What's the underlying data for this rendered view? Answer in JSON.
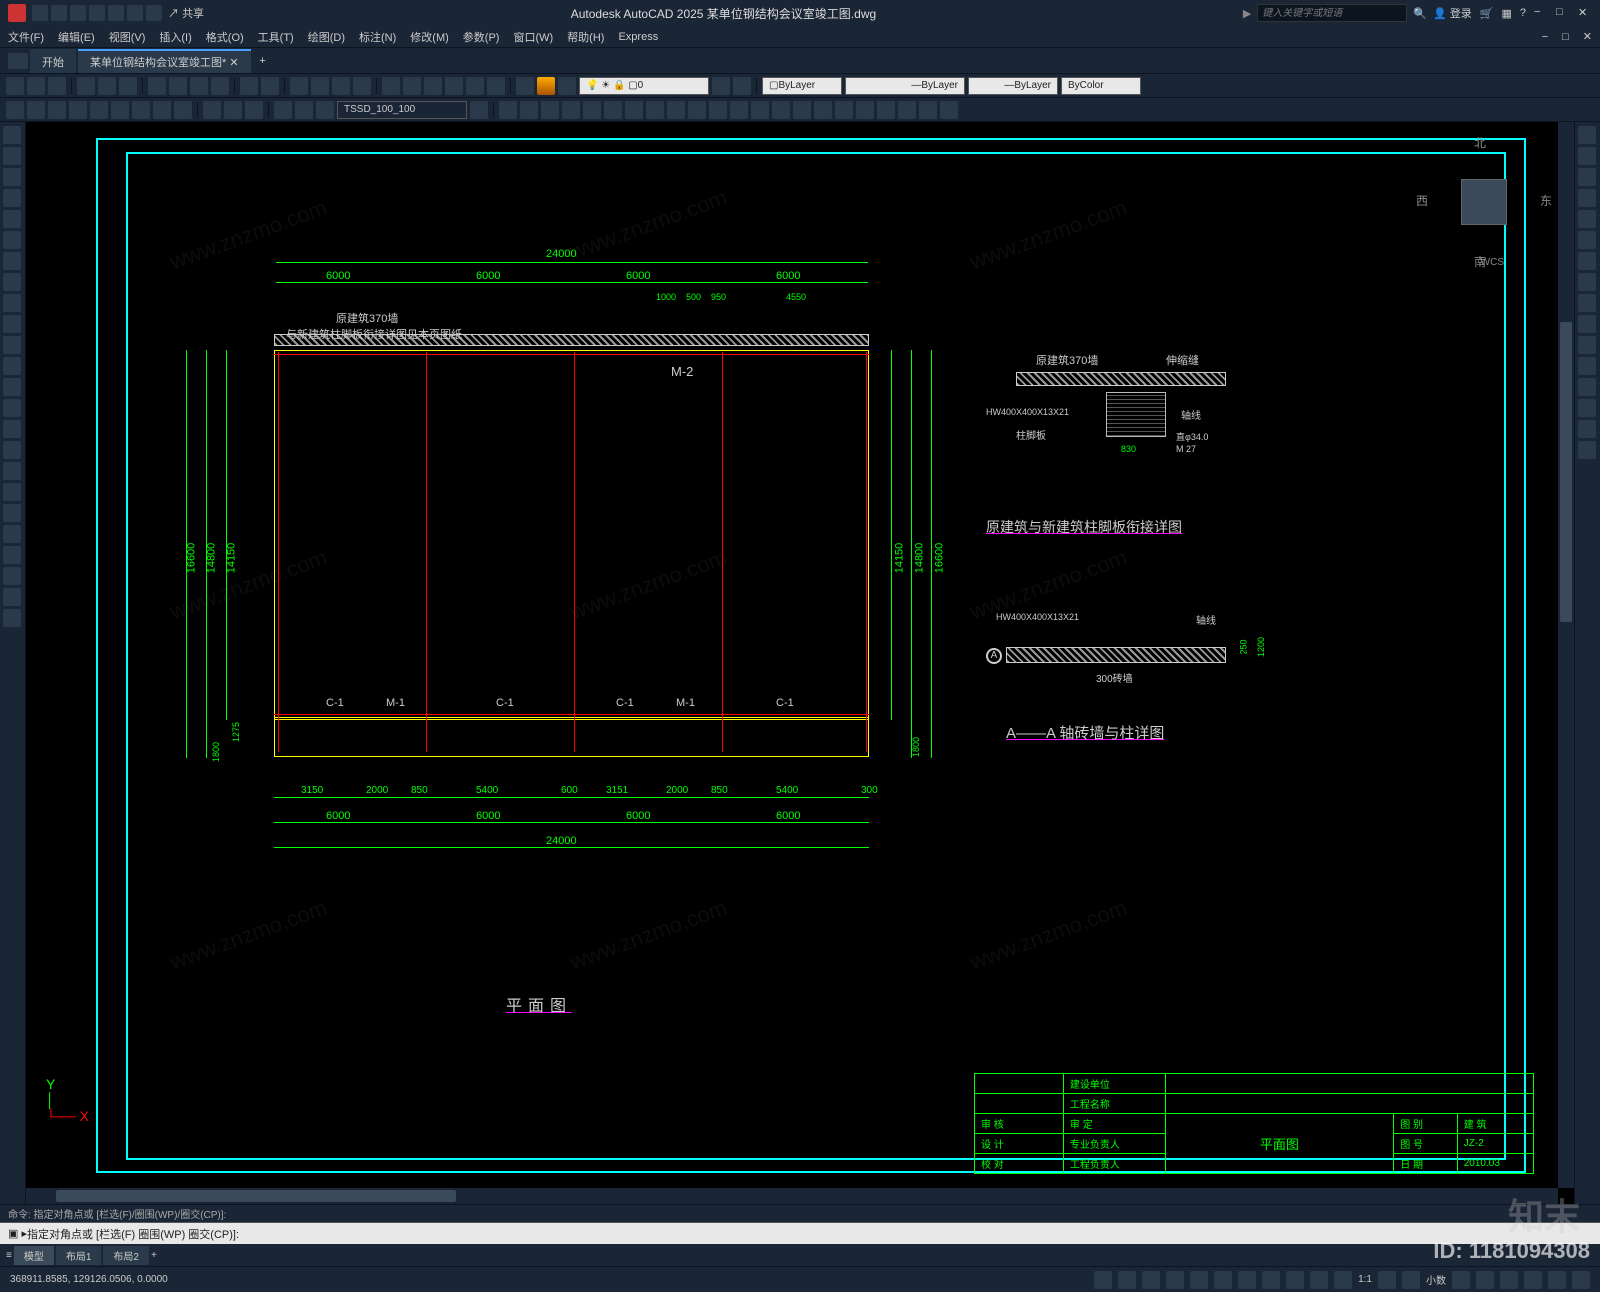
{
  "app": {
    "title": "Autodesk AutoCAD 2025   某单位钢结构会议室竣工图.dwg",
    "search_placeholder": "键入关键字或短语",
    "login": "登录",
    "share": "共享"
  },
  "menu": [
    "文件(F)",
    "编辑(E)",
    "视图(V)",
    "插入(I)",
    "格式(O)",
    "工具(T)",
    "绘图(D)",
    "标注(N)",
    "修改(M)",
    "参数(P)",
    "窗口(W)",
    "帮助(H)",
    "Express"
  ],
  "tabs": {
    "start": "开始",
    "file": "某单位钢结构会议室竣工图*"
  },
  "toolbar2": {
    "layer": "0",
    "bylayer": "ByLayer",
    "linetype": "ByLayer",
    "lineweight": "ByLayer",
    "bycolor": "ByColor",
    "tssd": "TSSD_100_100"
  },
  "viewcube": {
    "n": "北",
    "s": "南",
    "e": "东",
    "w": "西",
    "wcs": "WCS"
  },
  "drawing": {
    "total_width": "24000",
    "bay": "6000",
    "seg": [
      "1000",
      "500",
      "950",
      "4550"
    ],
    "height_total": "16600",
    "height_inner": "14800",
    "height_inner2": "14150",
    "h1": "1800",
    "h2": "1275",
    "note1": "原建筑370墙",
    "note2": "与新建筑柱脚板衔接详图见本页图纸",
    "m2": "M-2",
    "m1": "M-1",
    "c1": "C-1",
    "plan_title": "平面图",
    "bottom_dims": [
      "3150",
      "2000",
      "850",
      "5400",
      "600",
      "3151",
      "2000",
      "850",
      "5400",
      "300"
    ],
    "bottom_dims2": [
      "6000",
      "6000",
      "6000",
      "6000"
    ]
  },
  "detail1": {
    "t1": "原建筑370墙",
    "t2": "伸缩缝",
    "beam": "HW400X400X13X21",
    "col": "柱脚板",
    "axis": "轴线",
    "d830": "830",
    "m27": "M 27",
    "d34": "直φ34.0",
    "title": "原建筑与新建筑柱脚板衔接详图"
  },
  "detail2": {
    "beam": "HW400X400X13X21",
    "wall": "300砖墙",
    "axis": "轴线",
    "a": "A",
    "d250": "250",
    "d1200": "1200",
    "title": "A——A 轴砖墙与柱详图"
  },
  "titleblock": {
    "r1": [
      "",
      "建设单位",
      ""
    ],
    "r2": [
      "",
      "工程名称",
      ""
    ],
    "r3": [
      "审 核",
      "审 定",
      "",
      "图 别",
      "建 筑"
    ],
    "r4": [
      "设 计",
      "专业负责人",
      "平面图",
      "图 号",
      "JZ-2"
    ],
    "r5": [
      "校 对",
      "工程负责人",
      "",
      "日 期",
      "2010.03"
    ]
  },
  "cmd": {
    "history": "命令: 指定对角点或 [栏选(F)/圈围(WP)/圈交(CP)]:",
    "prompt": "指定对角点或 [栏选(F) 圈围(WP) 圈交(CP)]:"
  },
  "model_tabs": [
    "模型",
    "布局1",
    "布局2"
  ],
  "status": {
    "coords": "368911.8585, 129126.0506, 0.0000",
    "decimal": "小数",
    "scale": "1:1"
  },
  "watermark": "www.znzmo.com",
  "brand": "知末",
  "id": "ID: 1181094308"
}
